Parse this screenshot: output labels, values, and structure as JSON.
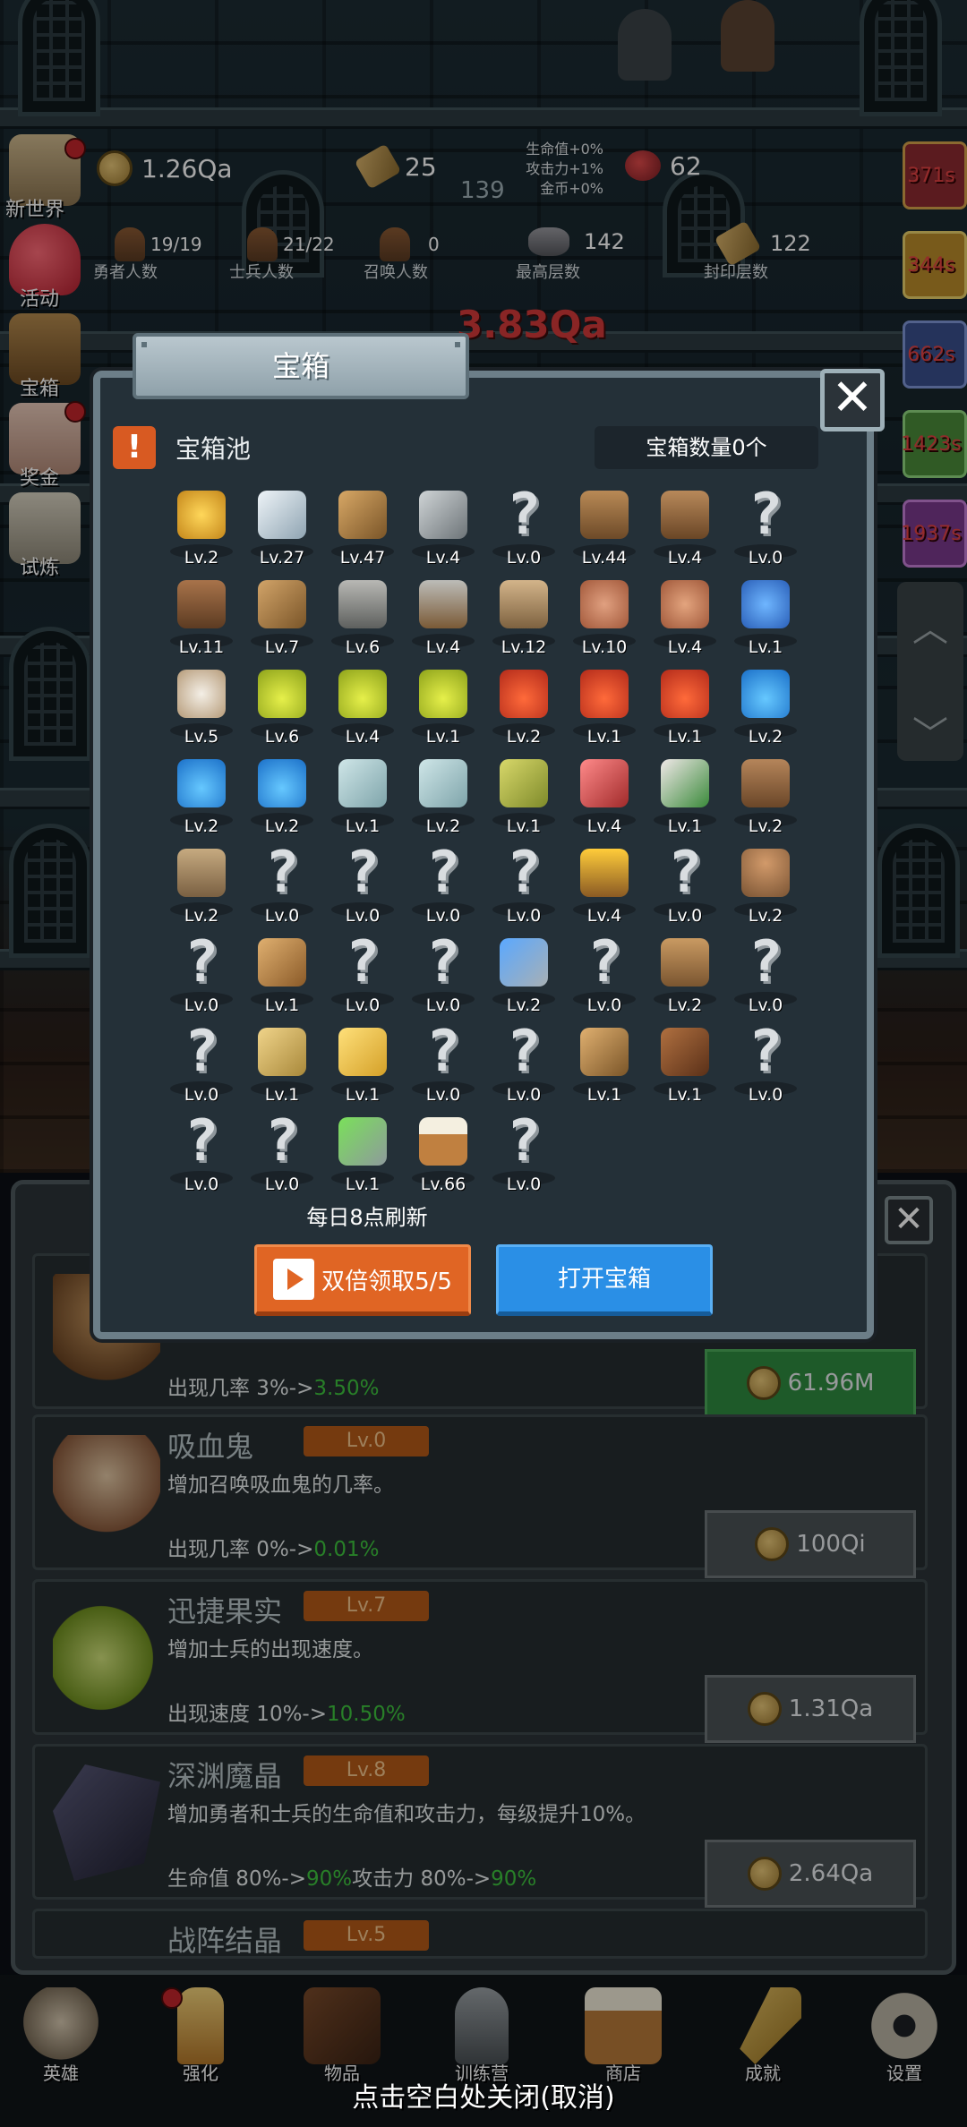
{
  "hud": {
    "gold": "1.26Qa",
    "scrolls": "25",
    "gems": "62",
    "buffs": [
      "生命值+0%",
      "攻击力+1%",
      "金币+0%"
    ],
    "floor_center": "139",
    "hero_count": "19/19",
    "hero_label": "勇者人数",
    "soldier_count": "21/22",
    "soldier_label": "士兵人数",
    "summon_count": "0",
    "summon_label": "召唤人数",
    "top_floor": "142",
    "top_floor_label": "最高层数",
    "sealed_floor": "122",
    "sealed_floor_label": "封印层数",
    "damage_text": "3.83Qa"
  },
  "side_menu": [
    "新世界",
    "活动",
    "宝箱",
    "奖金",
    "试炼"
  ],
  "timers": [
    "371s",
    "344s",
    "662s",
    "1423s",
    "1937s"
  ],
  "modal": {
    "title": "宝箱",
    "pool_title": "宝箱池",
    "chest_count": "宝箱数量0个",
    "refresh_note": "每日8点刷新",
    "double_btn": "双倍领取5/5",
    "open_btn": "打开宝箱",
    "items": [
      {
        "icon": "crown",
        "lv": "Lv.2"
      },
      {
        "icon": "diamond",
        "lv": "Lv.27"
      },
      {
        "icon": "wood-sword",
        "lv": "Lv.47"
      },
      {
        "icon": "iron-sword",
        "lv": "Lv.4"
      },
      {
        "icon": "unknown",
        "lv": "Lv.0"
      },
      {
        "icon": "chest-armor",
        "lv": "Lv.44"
      },
      {
        "icon": "leather-armor",
        "lv": "Lv.4"
      },
      {
        "icon": "unknown",
        "lv": "Lv.0"
      },
      {
        "icon": "leather-hood",
        "lv": "Lv.11"
      },
      {
        "icon": "dagger",
        "lv": "Lv.7"
      },
      {
        "icon": "knight-helmet",
        "lv": "Lv.6"
      },
      {
        "icon": "hammer",
        "lv": "Lv.4"
      },
      {
        "icon": "great-helm",
        "lv": "Lv.12"
      },
      {
        "icon": "ham",
        "lv": "Lv.10"
      },
      {
        "icon": "steak",
        "lv": "Lv.4"
      },
      {
        "icon": "loot-bag",
        "lv": "Lv.1"
      },
      {
        "icon": "rice",
        "lv": "Lv.5"
      },
      {
        "icon": "yellow-potion",
        "lv": "Lv.6"
      },
      {
        "icon": "yellow-potion",
        "lv": "Lv.4"
      },
      {
        "icon": "yellow-potion",
        "lv": "Lv.1"
      },
      {
        "icon": "red-potion",
        "lv": "Lv.2"
      },
      {
        "icon": "red-potion",
        "lv": "Lv.1"
      },
      {
        "icon": "red-potion",
        "lv": "Lv.1"
      },
      {
        "icon": "blue-potion",
        "lv": "Lv.2"
      },
      {
        "icon": "blue-potion",
        "lv": "Lv.2"
      },
      {
        "icon": "blue-potion",
        "lv": "Lv.2"
      },
      {
        "icon": "vial",
        "lv": "Lv.1"
      },
      {
        "icon": "vial",
        "lv": "Lv.2"
      },
      {
        "icon": "green-bottle",
        "lv": "Lv.1"
      },
      {
        "icon": "red-bottle",
        "lv": "Lv.4"
      },
      {
        "icon": "winged-boot",
        "lv": "Lv.1"
      },
      {
        "icon": "boot",
        "lv": "Lv.2"
      },
      {
        "icon": "shoe",
        "lv": "Lv.2"
      },
      {
        "icon": "unknown",
        "lv": "Lv.0"
      },
      {
        "icon": "unknown",
        "lv": "Lv.0"
      },
      {
        "icon": "unknown",
        "lv": "Lv.0"
      },
      {
        "icon": "unknown",
        "lv": "Lv.0"
      },
      {
        "icon": "torch",
        "lv": "Lv.4"
      },
      {
        "icon": "unknown",
        "lv": "Lv.0"
      },
      {
        "icon": "mushroom",
        "lv": "Lv.2"
      },
      {
        "icon": "unknown",
        "lv": "Lv.0"
      },
      {
        "icon": "staff",
        "lv": "Lv.1"
      },
      {
        "icon": "unknown",
        "lv": "Lv.0"
      },
      {
        "icon": "unknown",
        "lv": "Lv.0"
      },
      {
        "icon": "wand",
        "lv": "Lv.2"
      },
      {
        "icon": "unknown",
        "lv": "Lv.0"
      },
      {
        "icon": "backpack",
        "lv": "Lv.2"
      },
      {
        "icon": "unknown",
        "lv": "Lv.0"
      },
      {
        "icon": "unknown",
        "lv": "Lv.0"
      },
      {
        "icon": "club",
        "lv": "Lv.1"
      },
      {
        "icon": "cheese",
        "lv": "Lv.1"
      },
      {
        "icon": "unknown",
        "lv": "Lv.0"
      },
      {
        "icon": "unknown",
        "lv": "Lv.0"
      },
      {
        "icon": "bow",
        "lv": "Lv.1"
      },
      {
        "icon": "quiver",
        "lv": "Lv.1"
      },
      {
        "icon": "unknown",
        "lv": "Lv.0"
      },
      {
        "icon": "unknown",
        "lv": "Lv.0"
      },
      {
        "icon": "unknown",
        "lv": "Lv.0"
      },
      {
        "icon": "green-wand",
        "lv": "Lv.1"
      },
      {
        "icon": "beer-mug",
        "lv": "Lv.66"
      },
      {
        "icon": "unknown",
        "lv": "Lv.0"
      }
    ]
  },
  "upgrades": [
    {
      "name": "",
      "lv": "",
      "desc": "",
      "effect_prefix": "出现几率 3%->",
      "effect_new": "3.50%",
      "cost": "61.96M",
      "affordable": true
    },
    {
      "name": "吸血鬼",
      "lv": "Lv.0",
      "desc": "增加召唤吸血鬼的几率。",
      "effect_prefix": "出现几率 0%->",
      "effect_new": "0.01%",
      "cost": "100Qi",
      "affordable": false
    },
    {
      "name": "迅捷果实",
      "lv": "Lv.7",
      "desc": "增加士兵的出现速度。",
      "effect_prefix": "出现速度 10%->",
      "effect_new": "10.50%",
      "cost": "1.31Qa",
      "affordable": false
    },
    {
      "name": "深渊魔晶",
      "lv": "Lv.8",
      "desc": "增加勇者和士兵的生命值和攻击力，每级提升10%。",
      "effect_prefix": "生命值 80%->",
      "effect_new": "90%",
      "effect_prefix2": "攻击力 80%->",
      "effect_new2": "90%",
      "cost": "2.64Qa",
      "affordable": false
    },
    {
      "name": "战阵结晶",
      "lv": "Lv.5"
    }
  ],
  "bottom_nav": [
    "英雄",
    "强化",
    "物品",
    "训练营",
    "商店",
    "成就",
    "设置"
  ],
  "close_hint": "点击空白处关闭(取消)",
  "colors": {
    "accent_orange": "#e06524",
    "accent_blue": "#2a8fe6",
    "level_badge": "#b45a17",
    "effect_green": "#3ec43e",
    "damage_red": "#d33a3a"
  }
}
